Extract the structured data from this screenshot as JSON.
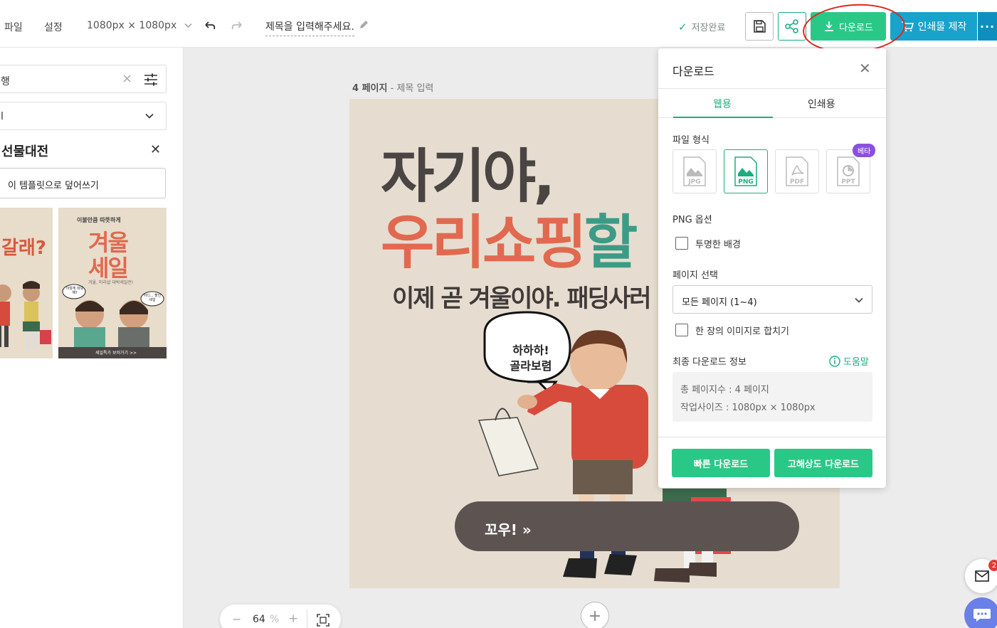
{
  "topbar": {
    "menu_file": "파일",
    "menu_settings": "설정",
    "size": "1080px × 1080px",
    "title_placeholder": "제목을 입력해주세요.",
    "saved_status": "저장완료",
    "download_label": "다운로드",
    "print_label": "인쇄물 제작",
    "more_label": "···"
  },
  "left_panel": {
    "search_value": "행",
    "dropdown_value": "l",
    "template_title": "선물대전",
    "overwrite_label": "이 템플릿으로 덮어쓰기",
    "thumb1": {
      "big": "갈래?"
    },
    "thumb2": {
      "tag": "이불만큼 따뜻하게",
      "big1": "겨울",
      "big2": "세일",
      "sub": "겨울, 미리샵 대박세일전!",
      "bubble": "이렇게 따뜻해?",
      "bubble2": "어디... 할인 세일",
      "cta": "세일특가 보러가기 >>"
    }
  },
  "canvas": {
    "page_number": "4 페이지",
    "page_title_placeholder": "- 제목 입력",
    "headline1": "자기야,",
    "headline2_a": "우리쇼핑",
    "headline2_b": "할",
    "subline": "이제 곧 겨울이야. 패딩사러",
    "bubble_line1": "하하하!",
    "bubble_line2": "골라보렴",
    "cta": "꼬우! »",
    "add_page": "+"
  },
  "zoom": {
    "minus": "−",
    "value": "64",
    "unit": "%",
    "plus": "+"
  },
  "download_popup": {
    "title": "다운로드",
    "tab_web": "웹용",
    "tab_print": "인쇄용",
    "file_format_label": "파일 형식",
    "formats": [
      "JPG",
      "PNG",
      "PDF",
      "PPT"
    ],
    "selected_format": "PNG",
    "beta_badge": "베타",
    "png_options_label": "PNG 옵션",
    "transparent_bg_label": "투명한 배경",
    "page_select_label": "페이지 선택",
    "page_select_value": "모든 페이지 (1~4)",
    "merge_label": "한 장의 이미지로 합치기",
    "final_info_label": "최종 다운로드 정보",
    "help_label": "도움말",
    "info_pages": "총 페이지수 : 4 페이지",
    "info_size": "작업사이즈 : 1080px × 1080px",
    "quick_download": "빠른 다운로드",
    "hires_download": "고해상도 다운로드"
  },
  "floating": {
    "mail_badge": "2"
  },
  "colors": {
    "accent_green": "#2ac887",
    "print_blue": "#17a3cc",
    "beta_purple": "#8b4fe0",
    "annotation_red": "#e0241f"
  }
}
